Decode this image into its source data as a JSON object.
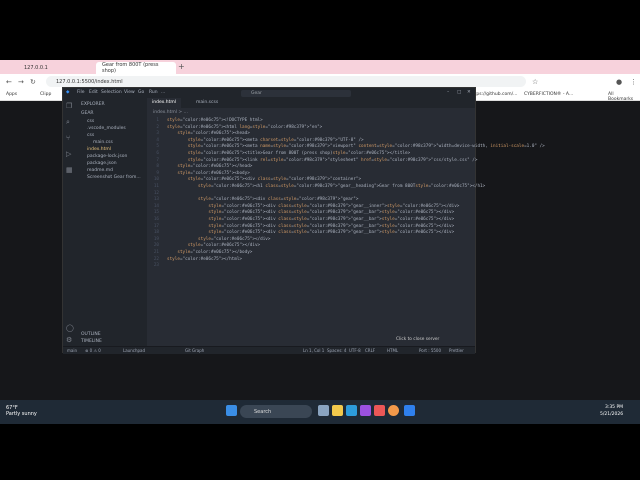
{
  "browser": {
    "tabs": [
      {
        "label": "127.0.0.1"
      },
      {
        "label": "Gear from 800T (press shop)"
      }
    ],
    "new_tab": "+",
    "address": "127.0.0.1:5500/index.html",
    "bookmarks": [
      "Apps",
      "Clipp",
      "https://github.com/...",
      "CYBERFICTION® - A...",
      "All Bookmarks"
    ]
  },
  "vscode": {
    "menu": [
      "File",
      "Edit",
      "Selection",
      "View",
      "Go",
      "Run",
      "..."
    ],
    "command_center": "Gear",
    "sidebar": {
      "header": "EXPLORER",
      "root": "GEAR",
      "items": [
        "css",
        ".vscode_modules",
        "css",
        "main.css",
        "index.html",
        "package-lock.json",
        "package.json",
        "readme.md",
        "Screenshot Gear from..."
      ],
      "outline": "OUTLINE",
      "timeline": "TIMELINE"
    },
    "tabs": [
      "index.html",
      "main.scss"
    ],
    "breadcrumb": "index.html > ...",
    "code": [
      "<!DOCTYPE html>",
      "<html lang=\"en\">",
      "    <head>",
      "        <meta charset=\"UTF-8\" />",
      "        <meta name=\"viewport\" content=\"width=device-width, initial-scale=1.0\" />",
      "        <title>Gear from 800T (press shop)</title>",
      "        <link rel=\"stylesheet\" href=\"css/style.css\" />",
      "    </head>",
      "    <body>",
      "        <div class=\"container\">",
      "            <h1 class=\"gear__heading\">Gear from 800T</h1>",
      "",
      "            <div class=\"gear\">",
      "                <div class=\"gear__inner\"></div>",
      "                <div class=\"gear__bar\"></div>",
      "                <div class=\"gear__bar\"></div>",
      "                <div class=\"gear__bar\"></div>",
      "                <div class=\"gear__bar\"></div>",
      "            </div>",
      "        </div>",
      "    </body>",
      "</html>",
      ""
    ],
    "status": {
      "branch": "main",
      "errors": "⊗ 0 ⚠ 0",
      "launchpad": "Launchpad",
      "git_graph": "Git Graph",
      "position": "Ln 1, Col 1",
      "spaces": "Spaces: 4",
      "encoding": "UTF-8",
      "eol": "CRLF",
      "language": "HTML",
      "port": "Port : 5500",
      "prettier": "Prettier"
    },
    "notification": "Click to close server"
  },
  "taskbar": {
    "weather_temp": "67°F",
    "weather_desc": "Partly sunny",
    "search": "Search",
    "time": "3:35 PM",
    "date": "5/21/2026"
  },
  "colors": {
    "tag": "#e06c75",
    "attr": "#d19a66",
    "string": "#98c379",
    "accent": "#3794ff"
  }
}
